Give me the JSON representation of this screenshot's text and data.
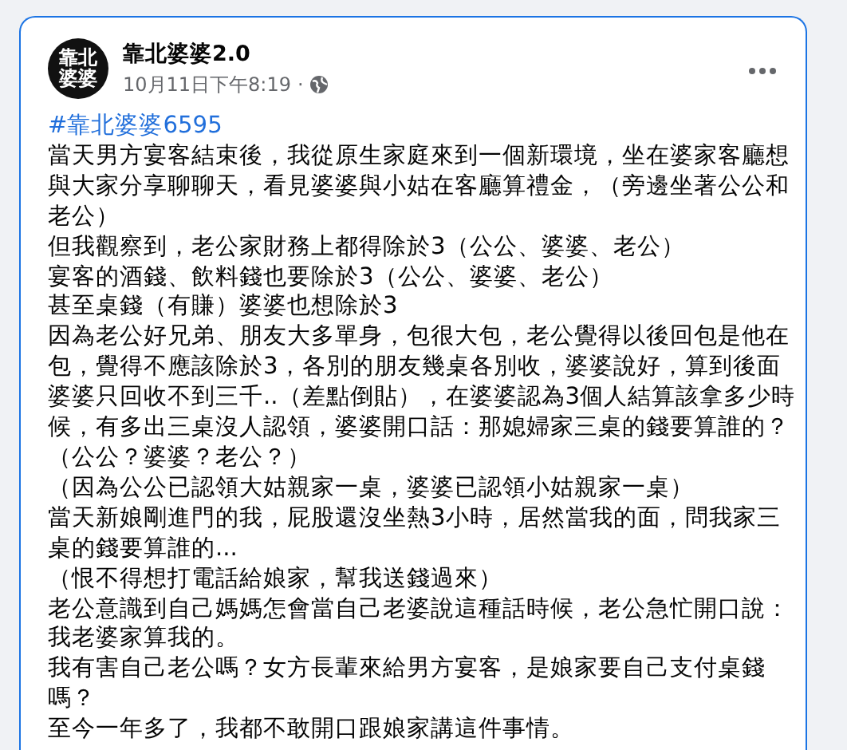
{
  "post": {
    "avatar_text": [
      "靠北",
      "婆婆"
    ],
    "author": "靠北婆婆2.0",
    "timestamp": "10月11日下午8:19",
    "separator": "·",
    "hashtag": "#靠北婆婆6595",
    "paragraphs": [
      "當天男方宴客結束後，我從原生家庭來到一個新環境，坐在婆家客廳想與大家分享聊聊天，看見婆婆與小姑在客廳算禮金，（旁邊坐著公公和老公）",
      "但我觀察到，老公家財務上都得除於3（公公、婆婆、老公）",
      "宴客的酒錢、飲料錢也要除於3（公公、婆婆、老公）",
      "甚至桌錢（有賺）婆婆也想除於3",
      "因為老公好兄弟、朋友大多單身，包很大包，老公覺得以後回包是他在包，覺得不應該除於3，各別的朋友幾桌各別收，婆婆說好，算到後面婆婆只回收不到三千..（差點倒貼），在婆婆認為3個人結算該拿多少時候，有多出三桌沒人認領，婆婆開口話：那媳婦家三桌的錢要算誰的？",
      "（公公？婆婆？老公？）",
      "（因為公公已認領大姑親家一桌，婆婆已認領小姑親家一桌）",
      "當天新娘剛進門的我，屁股還沒坐熱3小時，居然當我的面，問我家三桌的錢要算誰的...",
      "（恨不得想打電話給娘家，幫我送錢過來）",
      "老公意識到自己媽媽怎會當自己老婆說這種話時候，老公急忙開口說：我老婆家算我的。",
      "我有害自己老公嗎？女方長輩來給男方宴客，是娘家要自己支付桌錢嗎？",
      "至今一年多了，我都不敢開口跟娘家講這件事情。"
    ]
  }
}
